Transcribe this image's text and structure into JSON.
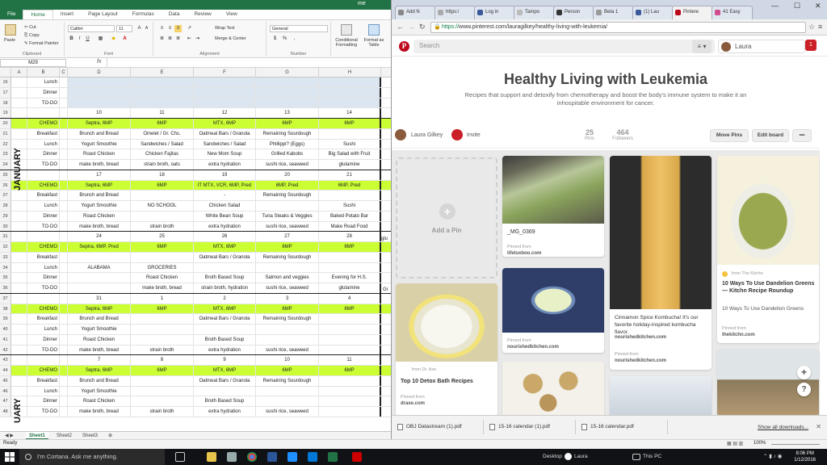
{
  "excel": {
    "title_fragment": "me",
    "tabs": [
      "File",
      "Home",
      "Insert",
      "Page Layout",
      "Formulas",
      "Data",
      "Review",
      "View"
    ],
    "ribbon": {
      "paste": "Paste",
      "cut": "Cut",
      "copy": "Copy",
      "format_painter": "Format Painter",
      "clipboard": "Clipboard",
      "font_name": "Calibri",
      "font_size": "11",
      "font": "Font",
      "wrap_text": "Wrap Text",
      "merge_center": "Merge & Center",
      "alignment": "Alignment",
      "number_format": "General",
      "number": "Number",
      "conditional_formatting": "Conditional Formatting",
      "format_as_table": "Format as Table"
    },
    "name_box": "M29",
    "fx": "fx",
    "columns": [
      "A",
      "B",
      "C",
      "D",
      "E",
      "F",
      "G",
      "H"
    ],
    "months": [
      "JANUARY",
      "UARY"
    ],
    "rows": [
      {
        "n": "16",
        "c": [
          "",
          "Lunch",
          "",
          "",
          "",
          "",
          "",
          ""
        ],
        "blue": true
      },
      {
        "n": "17",
        "c": [
          "",
          "Dinner",
          "",
          "",
          "",
          "",
          "",
          ""
        ],
        "blue": true
      },
      {
        "n": "18",
        "c": [
          "",
          "TO-DO",
          "",
          "",
          "",
          "",
          "",
          ""
        ],
        "blue": true
      },
      {
        "n": "19",
        "c": [
          "",
          "",
          "",
          "10",
          "11",
          "12",
          "13",
          "14"
        ],
        "hdr": true
      },
      {
        "n": "20",
        "c": [
          "",
          "CHEMO",
          "",
          "Septra, 6MP",
          "6MP",
          "MTX, 6MP",
          "6MP",
          "6MP"
        ],
        "chemo": true
      },
      {
        "n": "21",
        "c": [
          "",
          "Breakfast",
          "",
          "Brunch and Bread",
          "Omelet / Gr. Chs.",
          "Oatmeal Bars / Granola",
          "Remaining Sourdough",
          ""
        ]
      },
      {
        "n": "22",
        "c": [
          "",
          "Lunch",
          "",
          "Yogurt Smoothie",
          "Sandwiches / Salad",
          "Sandwiches / Salad",
          "Phillippi? (Eggs)",
          "Sushi"
        ]
      },
      {
        "n": "23",
        "c": [
          "",
          "Dinner",
          "",
          "Roast Chicken",
          "Chicken Fajitas",
          "New Mom Soup",
          "Grilled Kabobs",
          "Big Salad with Fruit"
        ]
      },
      {
        "n": "24",
        "c": [
          "",
          "TO-DO",
          "",
          "make broth, bread",
          "strain broth, oats",
          "extra hydration",
          "sushi rice, seaweed",
          "glutamine"
        ],
        "hdr": true
      },
      {
        "n": "25",
        "c": [
          "",
          "",
          "",
          "17",
          "18",
          "19",
          "20",
          "21"
        ]
      },
      {
        "n": "26",
        "c": [
          "",
          "CHEMO",
          "",
          "Septra, 6MP",
          "6MP",
          "IT MTX, VCR, 6MP, Pred",
          "6MP, Pred",
          "6MP, Pred"
        ],
        "chemo": true
      },
      {
        "n": "27",
        "c": [
          "",
          "Breakfast",
          "",
          "Brunch and Bread",
          "",
          "-",
          "Remaining Sourdough",
          ""
        ]
      },
      {
        "n": "28",
        "c": [
          "",
          "Lunch",
          "",
          "Yogurt Smoothie",
          "NO SCHOOL",
          "Chicken Salad",
          "",
          "Sushi"
        ]
      },
      {
        "n": "29",
        "c": [
          "",
          "Dinner",
          "",
          "Roast Chicken",
          "",
          "White Bean Soup",
          "Tuna Steaks & Veggies",
          "Baked Potato Bar"
        ]
      },
      {
        "n": "30",
        "c": [
          "",
          "TO-DO",
          "",
          "make broth, bread",
          "strain broth",
          "extra hydration",
          "sushi rice, seaweed",
          "Make Road Food"
        ],
        "hdr": true
      },
      {
        "n": "31",
        "c": [
          "",
          "",
          "",
          "24",
          "25",
          "26",
          "27",
          "28"
        ]
      },
      {
        "n": "32",
        "c": [
          "",
          "CHEMO",
          "",
          "Septra, 6MP, Pred",
          "6MP",
          "MTX, 6MP",
          "6MP",
          "6MP"
        ],
        "chemo": true
      },
      {
        "n": "33",
        "c": [
          "",
          "Breakfast",
          "",
          "",
          "",
          "Oatmeal Bars / Granola",
          "Remaining Sourdough",
          ""
        ]
      },
      {
        "n": "34",
        "c": [
          "",
          "Lunch",
          "",
          "ALABAMA",
          "GROCERIES",
          "",
          "",
          ""
        ]
      },
      {
        "n": "35",
        "c": [
          "",
          "Dinner",
          "",
          "",
          "Roast Chicken",
          "Broth Based Soup",
          "Salmon and veggies",
          "Evening for H.S."
        ]
      },
      {
        "n": "36",
        "c": [
          "",
          "TO-DO",
          "",
          "",
          "make broth, bread",
          "strain broth, hydration",
          "sushi rice, seaweed",
          "glutamine"
        ],
        "hdr": true
      },
      {
        "n": "37",
        "c": [
          "",
          "",
          "",
          "31",
          "1",
          "2",
          "3",
          "4"
        ]
      },
      {
        "n": "38",
        "c": [
          "",
          "CHEMO",
          "",
          "Septra, 6MP",
          "6MP",
          "MTX, 6MP",
          "6MP",
          "6MP"
        ],
        "chemo": true
      },
      {
        "n": "39",
        "c": [
          "",
          "Breakfast",
          "",
          "Brunch and Bread",
          "",
          "Oatmeal Bars / Granola",
          "Remaining Sourdough",
          ""
        ]
      },
      {
        "n": "40",
        "c": [
          "",
          "Lunch",
          "",
          "Yogurt Smoothie",
          "",
          "",
          "",
          ""
        ]
      },
      {
        "n": "41",
        "c": [
          "",
          "Dinner",
          "",
          "Roast Chicken",
          "",
          "Broth Based Soup",
          "",
          ""
        ]
      },
      {
        "n": "42",
        "c": [
          "",
          "TO-DO",
          "",
          "make broth, bread",
          "strain broth",
          "extra hydration",
          "sushi rice, seaweed",
          ""
        ],
        "hdr": true
      },
      {
        "n": "43",
        "c": [
          "",
          "",
          "",
          "7",
          "8",
          "9",
          "10",
          "11"
        ]
      },
      {
        "n": "44",
        "c": [
          "",
          "CHEMO",
          "",
          "Septra, 6MP",
          "6MP",
          "MTX, 6MP",
          "6MP",
          "6MP"
        ],
        "chemo": true
      },
      {
        "n": "45",
        "c": [
          "",
          "Breakfast",
          "",
          "Brunch and Bread",
          "",
          "Oatmeal Bars / Granola",
          "Remaining Sourdough",
          ""
        ]
      },
      {
        "n": "46",
        "c": [
          "",
          "Lunch",
          "",
          "Yogurt Smoothie",
          "",
          "",
          "",
          ""
        ]
      },
      {
        "n": "47",
        "c": [
          "",
          "Dinner",
          "",
          "Roast Chicken",
          "",
          "Broth Based Soup",
          "",
          ""
        ]
      },
      {
        "n": "48",
        "c": [
          "",
          "TO-DO",
          "",
          "make broth, bread",
          "strain broth",
          "extra hydration",
          "sushi rice, seaweed",
          ""
        ]
      }
    ],
    "overflow_text": [
      "glu",
      "Gr"
    ],
    "sheets": [
      "Sheet1",
      "Sheet2",
      "Sheet3"
    ],
    "status": "Ready",
    "zoom": "100%"
  },
  "browser": {
    "tabs": [
      {
        "label": "Add N",
        "color": "#888888"
      },
      {
        "label": "https:/",
        "color": "#aaaaaa"
      },
      {
        "label": "Log in",
        "color": "#3b5998"
      },
      {
        "label": "Tampo",
        "color": "#bbbbbb"
      },
      {
        "label": "Person",
        "color": "#333333"
      },
      {
        "label": "Beta 1",
        "color": "#999999"
      },
      {
        "label": "(1) Lau",
        "color": "#3b5998"
      },
      {
        "label": "Pintere",
        "color": "#bd081c"
      },
      {
        "label": "41 Easy",
        "color": "#d14b8f"
      }
    ],
    "url_https": "https://",
    "url_rest": "www.pinterest.com/lauragilkey/healthy-living-with-leukemia/",
    "downloads": [
      "OBJ Datastream (1).pdf",
      "15-16 calendar (1).pdf",
      "15-16 calendar.pdf"
    ],
    "show_all": "Show all downloads..."
  },
  "pinterest": {
    "search_placeholder": "Search",
    "user": "Laura",
    "notif_count": "1",
    "board_title": "Healthy Living with Leukemia",
    "board_desc": "Recipes that support and detoxify from chemotherapy and boost the body's immune system to make it an inhospitable environment for cancer.",
    "owner": "Laura Gilkey",
    "invite": "Invite",
    "pins_count": "25",
    "pins_label": "Pins",
    "followers_count": "464",
    "followers_label": "Followers",
    "move_pins": "Move Pins",
    "edit_board": "Edit board",
    "more": "•••",
    "add_pin": "Add a Pin",
    "pinned_from": "Pinned from",
    "pin1": {
      "title": "_MG_0369",
      "source": "lifeluxboo.com"
    },
    "pin2": {
      "from": "from Dr. Axe",
      "title": "Top 10 Detox Bath Recipes",
      "source": "draxe.com"
    },
    "pin3": {
      "source": "nourishedkitchen.com"
    },
    "pin4": {
      "desc": "Cinnamon Spice Kombucha! It's our favorite holiday-inspired kombucha flavor.",
      "author": "nourishedkitchen.com",
      "source": "nourishedkitchen.com"
    },
    "pin5": {
      "from": "from The Kitchn",
      "title": "10 Ways To Use Dandelion Greens — Kitchn Recipe Roundup",
      "desc": "10 Ways To Use Dandelion Greens",
      "source": "thekitchn.com"
    }
  },
  "taskbar": {
    "cortana": "I'm Cortana. Ask me anything.",
    "desktop": "Desktop",
    "laura": "Laura",
    "this_pc": "This PC",
    "time": "8:06 PM",
    "date": "1/12/2016"
  }
}
